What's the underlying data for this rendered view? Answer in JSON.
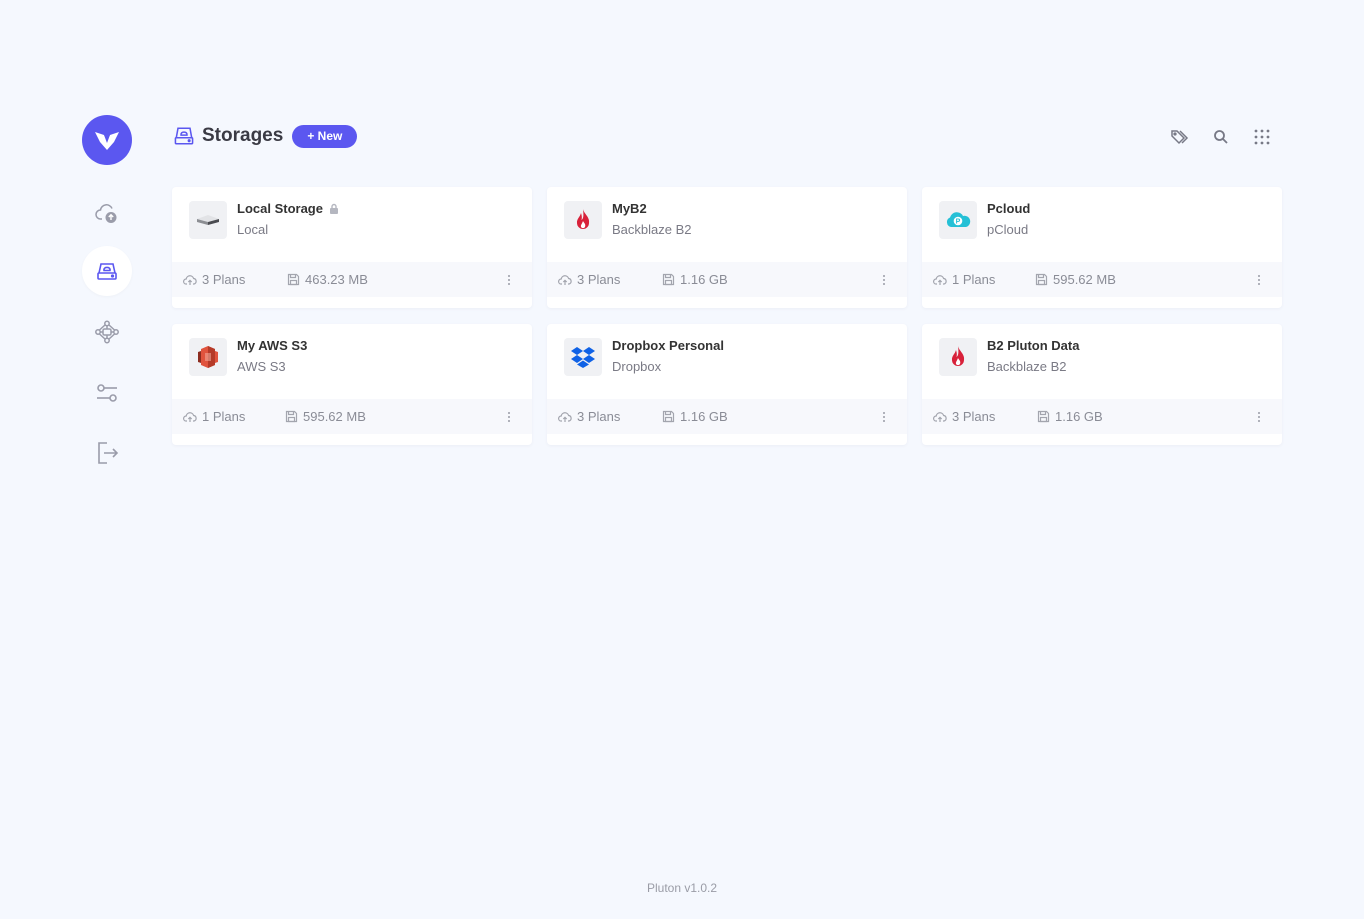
{
  "header": {
    "title": "Storages",
    "new_button": "+ New"
  },
  "sidebar": {
    "items": [
      {
        "name": "backups",
        "icon": "cloud-upload-icon"
      },
      {
        "name": "storages",
        "icon": "storage-drive-icon",
        "active": true
      },
      {
        "name": "devices",
        "icon": "network-icon"
      },
      {
        "name": "settings",
        "icon": "sliders-icon"
      },
      {
        "name": "logout",
        "icon": "logout-icon"
      }
    ]
  },
  "storages": [
    {
      "name": "Local Storage",
      "type": "Local",
      "plans": "3 Plans",
      "size": "463.23 MB",
      "locked": true,
      "icon": "local-drive-icon"
    },
    {
      "name": "MyB2",
      "type": "Backblaze B2",
      "plans": "3 Plans",
      "size": "1.16 GB",
      "icon": "backblaze-flame-icon"
    },
    {
      "name": "Pcloud",
      "type": "pCloud",
      "plans": "1 Plans",
      "size": "595.62 MB",
      "icon": "pcloud-icon"
    },
    {
      "name": "My AWS S3",
      "type": "AWS S3",
      "plans": "1 Plans",
      "size": "595.62 MB",
      "icon": "aws-s3-icon"
    },
    {
      "name": "Dropbox Personal",
      "type": "Dropbox",
      "plans": "3 Plans",
      "size": "1.16 GB",
      "icon": "dropbox-icon"
    },
    {
      "name": "B2 Pluton Data",
      "type": "Backblaze B2",
      "plans": "3 Plans",
      "size": "1.16 GB",
      "icon": "backblaze-flame-icon"
    }
  ],
  "footer": {
    "version": "Pluton v1.0.2"
  },
  "colors": {
    "accent": "#5b57f0",
    "background": "#f5f8fe"
  }
}
